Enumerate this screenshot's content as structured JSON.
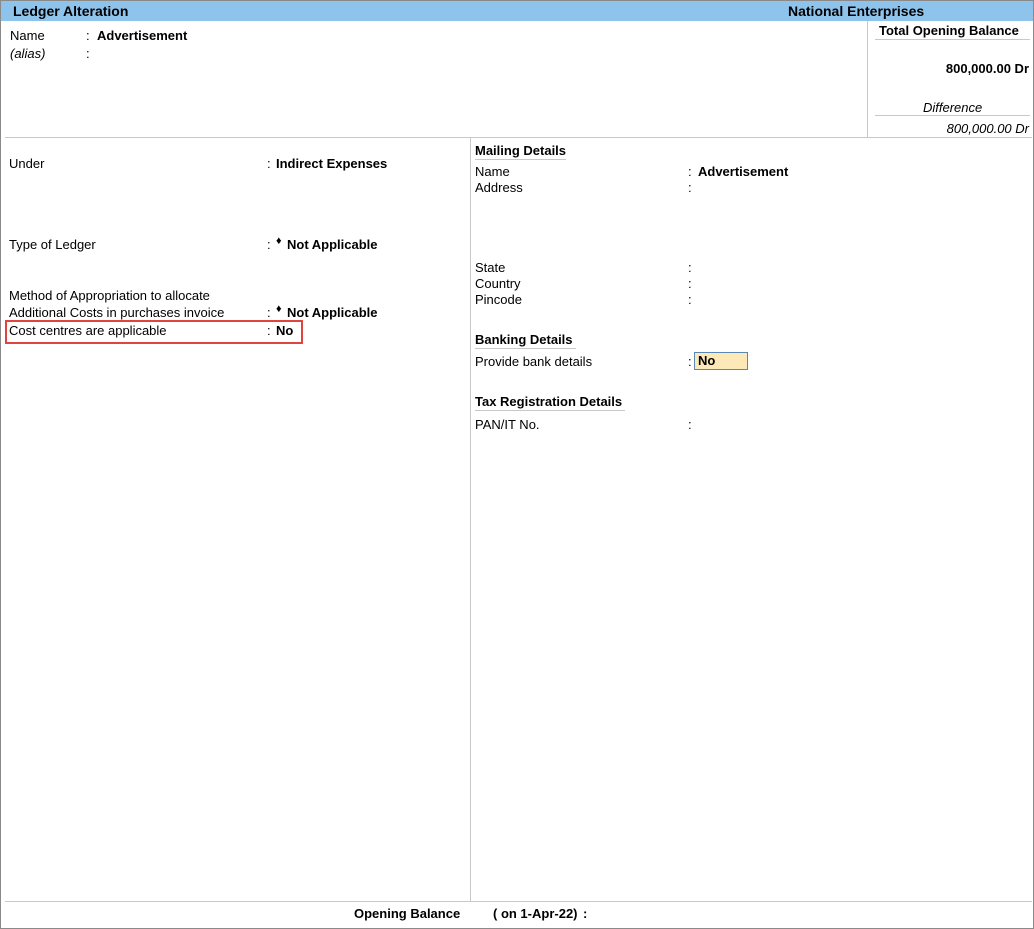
{
  "header": {
    "title": "Ledger Alteration",
    "company": "National Enterprises"
  },
  "ledger": {
    "name_label": "Name",
    "name_value": "Advertisement",
    "alias_label": "(alias)",
    "colon": ":"
  },
  "balance_panel": {
    "total_label": "Total Opening Balance",
    "total_value": "800,000.00 Dr",
    "difference_label": "Difference",
    "difference_value": "800,000.00 Dr"
  },
  "left_fields": {
    "under_label": "Under",
    "under_value": "Indirect Expenses",
    "type_label": "Type of Ledger",
    "type_value": "Not Applicable",
    "method_label_line1": "Method of Appropriation to allocate",
    "method_label_line2": "Additional Costs in purchases invoice",
    "method_value": "Not Applicable",
    "cost_centres_label": "Cost centres are applicable",
    "cost_centres_value": "No",
    "diamond": "♦"
  },
  "mailing": {
    "heading": "Mailing Details",
    "name_label": "Name",
    "name_value": "Advertisement",
    "address_label": "Address",
    "state_label": "State",
    "country_label": "Country",
    "pincode_label": "Pincode"
  },
  "banking": {
    "heading": "Banking Details",
    "bank_label": "Provide bank details",
    "bank_value": "No"
  },
  "tax": {
    "heading": "Tax Registration Details",
    "pan_label": "PAN/IT No."
  },
  "footer": {
    "opening_label": "Opening Balance",
    "date_text": "( on 1-Apr-22)",
    "colon": ":"
  }
}
